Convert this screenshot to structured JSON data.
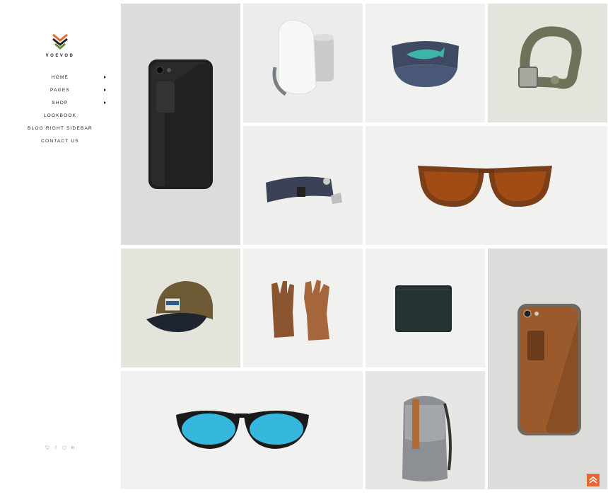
{
  "brand": {
    "name": "VOEVOD",
    "logo_icon": "chevron-stack-logo-icon"
  },
  "nav": {
    "items": [
      {
        "label": "HOME",
        "has_submenu": true
      },
      {
        "label": "PAGES",
        "has_submenu": true
      },
      {
        "label": "SHOP",
        "has_submenu": true
      },
      {
        "label": "LOOKBOOK",
        "has_submenu": false
      },
      {
        "label": "BLOG RIGHT SIDEBAR",
        "has_submenu": false
      },
      {
        "label": "CONTACT US",
        "has_submenu": false
      }
    ]
  },
  "social": {
    "icons": [
      "twitter-icon",
      "facebook-icon",
      "instagram-icon",
      "linkedin-icon"
    ]
  },
  "products": [
    "black-phone-case",
    "white-bottle-bag",
    "navy-fish-visor",
    "olive-belt",
    "navy-woven-belt",
    "tortoise-sunglasses",
    "brown-patch-cap",
    "leather-gloves",
    "black-wallet",
    "leather-phone-case",
    "blue-lens-sunglasses",
    "grey-backpack"
  ],
  "colors": {
    "accent": "#e5682f",
    "tile_light": "#f1f1f0",
    "tile_grey": "#dcdcdc",
    "camo": "#e3e5dc"
  },
  "back_to_top_icon": "double-chevron-up-icon"
}
